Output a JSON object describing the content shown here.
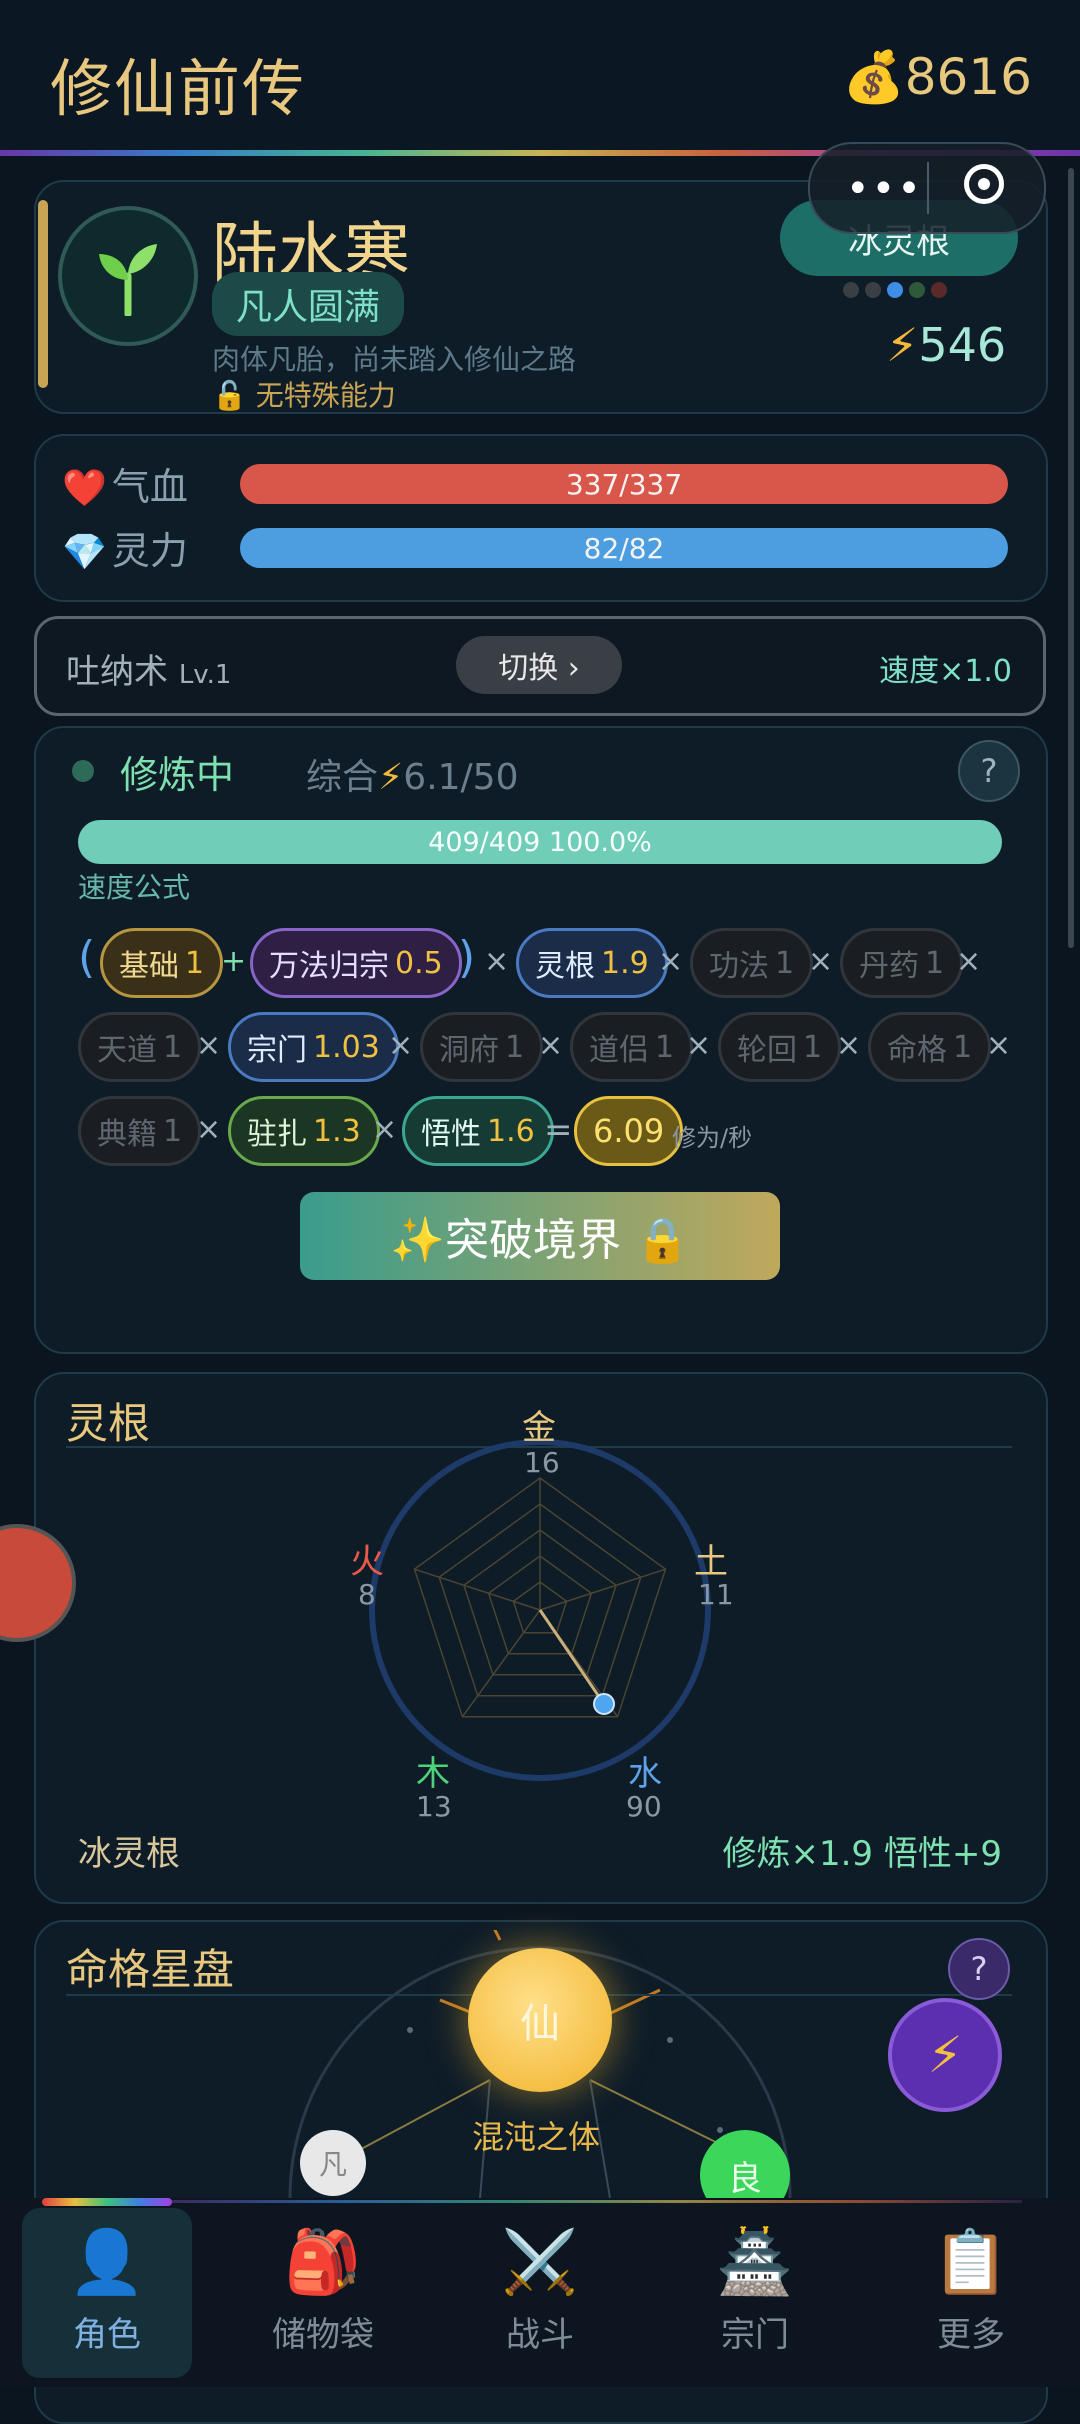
{
  "header": {
    "title": "修仙前传",
    "coins": "8616",
    "coin_icon": "money-bag-icon"
  },
  "capsule": {
    "more_glyph": "•••",
    "close_icon": "target-icon"
  },
  "profile": {
    "name": "陆水寒",
    "realm": "凡人圆满",
    "description": "肉体凡胎，尚未踏入修仙之路",
    "ability": "无特殊能力",
    "root_label": "冰灵根",
    "power": "546",
    "root_dot_colors": [
      "#3a3f44",
      "#3a3f44",
      "#3e8ee6",
      "#2f5a3a",
      "#5a2a2a"
    ]
  },
  "stats": {
    "hp": {
      "label": "气血",
      "value": "337/337",
      "fill": 1.0,
      "color": "#d9574a"
    },
    "mp": {
      "label": "灵力",
      "value": "82/82",
      "fill": 1.0,
      "color": "#4c9ee0"
    }
  },
  "technique": {
    "name": "吐纳术",
    "level": "Lv.1",
    "switch_label": "切换 ›",
    "speed": "速度×1.0"
  },
  "cultivation": {
    "status": "修炼中",
    "total_label": "综合",
    "total_value": "6.1/50",
    "progress_text": "409/409  100.0%",
    "progress": 1.0,
    "formula_title": "速度公式",
    "help": "?",
    "breakthrough": "✨突破境界 🔒",
    "result": "6.09",
    "result_unit": "修为/秒",
    "chips": [
      {
        "label": "基础",
        "value": "1",
        "style": "gold"
      },
      {
        "label": "万法归宗",
        "value": "0.5",
        "style": "purple"
      },
      {
        "label": "灵根",
        "value": "1.9",
        "style": "blue"
      },
      {
        "label": "功法",
        "value": "1",
        "style": "dim"
      },
      {
        "label": "丹药",
        "value": "1",
        "style": "dim"
      },
      {
        "label": "天道",
        "value": "1",
        "style": "dim"
      },
      {
        "label": "宗门",
        "value": "1.03",
        "style": "blue"
      },
      {
        "label": "洞府",
        "value": "1",
        "style": "dim"
      },
      {
        "label": "道侣",
        "value": "1",
        "style": "dim"
      },
      {
        "label": "轮回",
        "value": "1",
        "style": "dim"
      },
      {
        "label": "命格",
        "value": "1",
        "style": "dim"
      },
      {
        "label": "典籍",
        "value": "1",
        "style": "dim"
      },
      {
        "label": "驻扎",
        "value": "1.3",
        "style": "green"
      },
      {
        "label": "悟性",
        "value": "1.6",
        "style": "teal"
      }
    ]
  },
  "spirit_root": {
    "title": "灵根",
    "elements": [
      {
        "name": "金",
        "value": "16",
        "color": "#e8c77f"
      },
      {
        "name": "土",
        "value": "11",
        "color": "#e8c77f"
      },
      {
        "name": "水",
        "value": "90",
        "color": "#5fa2e8"
      },
      {
        "name": "木",
        "value": "13",
        "color": "#4fd07a"
      },
      {
        "name": "火",
        "value": "8",
        "color": "#e85a4a"
      }
    ],
    "root_type": "冰灵根",
    "bonus": "修炼×1.9  悟性+9"
  },
  "star_chart": {
    "title": "命格星盘",
    "help": "?",
    "center": "仙",
    "center_label": "混沌之体",
    "node_left": "凡",
    "node_right": "良",
    "action_icon": "lightning-icon"
  },
  "nav": [
    {
      "label": "角色",
      "icon": "👤",
      "active": true
    },
    {
      "label": "储物袋",
      "icon": "🎒",
      "active": false
    },
    {
      "label": "战斗",
      "icon": "⚔️",
      "active": false
    },
    {
      "label": "宗门",
      "icon": "🏯",
      "active": false
    },
    {
      "label": "更多",
      "icon": "📋",
      "active": false
    }
  ]
}
